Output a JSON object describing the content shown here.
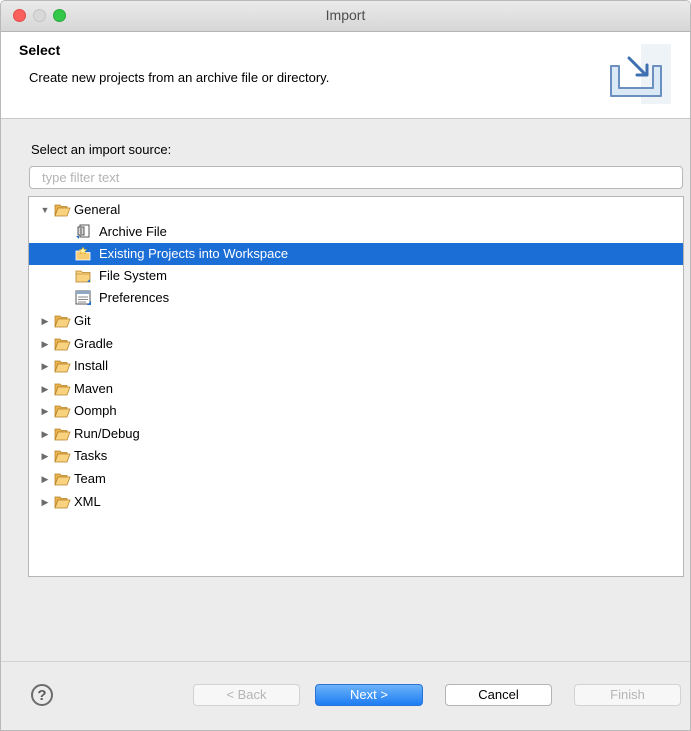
{
  "window": {
    "title": "Import"
  },
  "banner": {
    "title": "Select",
    "description": "Create new projects from an archive file or directory.",
    "icon": "import-wizard-icon"
  },
  "source": {
    "label": "Select an import source:",
    "filter_placeholder": "type filter text",
    "filter_value": ""
  },
  "tree": {
    "general": {
      "label": "General",
      "expanded": true,
      "children": [
        {
          "label": "Archive File",
          "icon": "archive-file-icon"
        },
        {
          "label": "Existing Projects into Workspace",
          "icon": "existing-projects-icon",
          "selected": true
        },
        {
          "label": "File System",
          "icon": "folder-icon"
        },
        {
          "label": "Preferences",
          "icon": "preferences-icon"
        }
      ]
    },
    "categories": [
      {
        "label": "Git"
      },
      {
        "label": "Gradle"
      },
      {
        "label": "Install"
      },
      {
        "label": "Maven"
      },
      {
        "label": "Oomph"
      },
      {
        "label": "Run/Debug"
      },
      {
        "label": "Tasks"
      },
      {
        "label": "Team"
      },
      {
        "label": "XML"
      }
    ]
  },
  "buttons": {
    "help": "?",
    "back": "< Back",
    "next": "Next >",
    "cancel": "Cancel",
    "finish": "Finish"
  },
  "colors": {
    "selection": "#1a6ed6",
    "folder": "#f5c86a",
    "primary_button": "#1d7cf2"
  }
}
